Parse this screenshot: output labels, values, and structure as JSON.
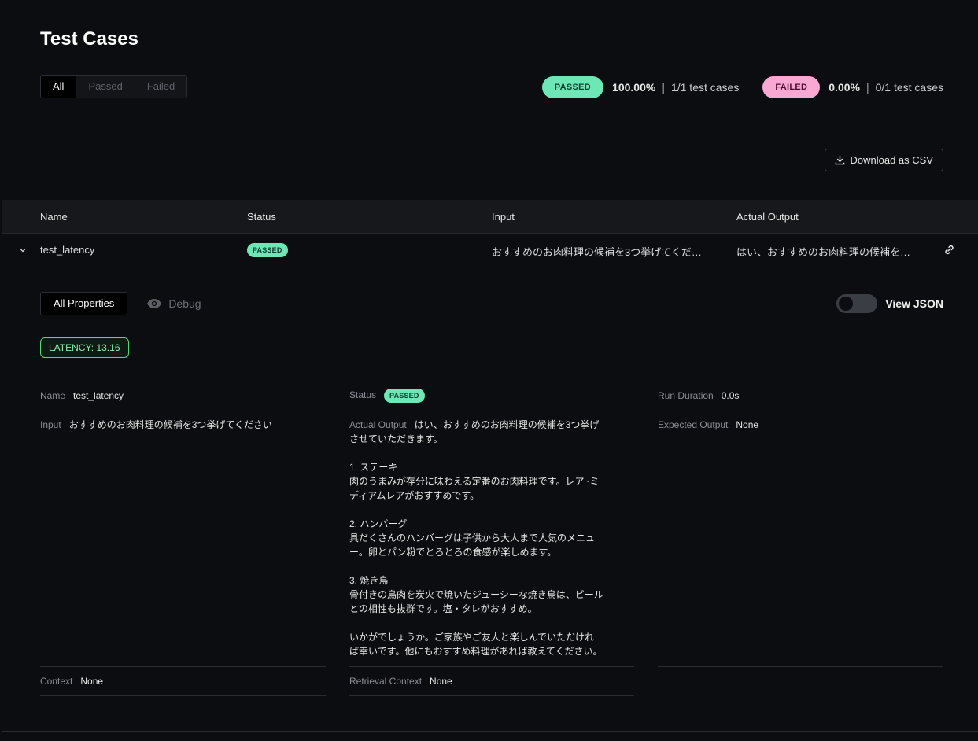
{
  "title": "Test Cases",
  "filters": [
    "All",
    "Passed",
    "Failed"
  ],
  "summary": {
    "passed": {
      "label": "PASSED",
      "pct": "100.00%",
      "count": "1/1 test cases"
    },
    "failed": {
      "label": "FAILED",
      "pct": "0.00%",
      "count": "0/1 test cases"
    },
    "separator": "|"
  },
  "download_label": "Download as CSV",
  "table": {
    "headers": [
      "Name",
      "Status",
      "Input",
      "Actual Output"
    ],
    "row": {
      "name": "test_latency",
      "status": "PASSED",
      "input": "おすすめのお肉料理の候補を3つ挙げてくだ…",
      "output": "はい、おすすめのお肉料理の候補を…"
    }
  },
  "detail": {
    "tab_all": "All Properties",
    "tab_debug": "Debug",
    "view_json": "View JSON",
    "metric": "LATENCY: 13.16",
    "name_label": "Name",
    "name_value": "test_latency",
    "status_label": "Status",
    "status_value": "PASSED",
    "duration_label": "Run Duration",
    "duration_value": "0.0s",
    "input_label": "Input",
    "input_value": "おすすめのお肉料理の候補を3つ挙げてください",
    "output_label": "Actual Output",
    "output_value": "はい、おすすめのお肉料理の候補を3つ挙げさせていただきます。\n\n1. ステーキ\n肉のうまみが存分に味わえる定番のお肉料理です。レア~ミディアムレアがおすすめです。\n\n2. ハンバーグ\n具だくさんのハンバーグは子供から大人まで人気のメニュー。卵とパン粉でとろとろの食感が楽しめます。\n\n3. 焼き鳥\n骨付きの鳥肉を炭火で焼いたジューシーな焼き鳥は、ビールとの相性も抜群です。塩・タレがおすすめ。\n\nいかがでしょうか。ご家族やご友人と楽しんでいただければ幸いです。他にもおすすめ料理があれば教えてください。",
    "expected_label": "Expected Output",
    "expected_value": "None",
    "context_label": "Context",
    "context_value": "None",
    "retrieval_label": "Retrieval Context",
    "retrieval_value": "None"
  },
  "colors": {
    "pass": "#6ee7b7",
    "fail": "#f9a8d4",
    "metric": "#4ade80"
  }
}
